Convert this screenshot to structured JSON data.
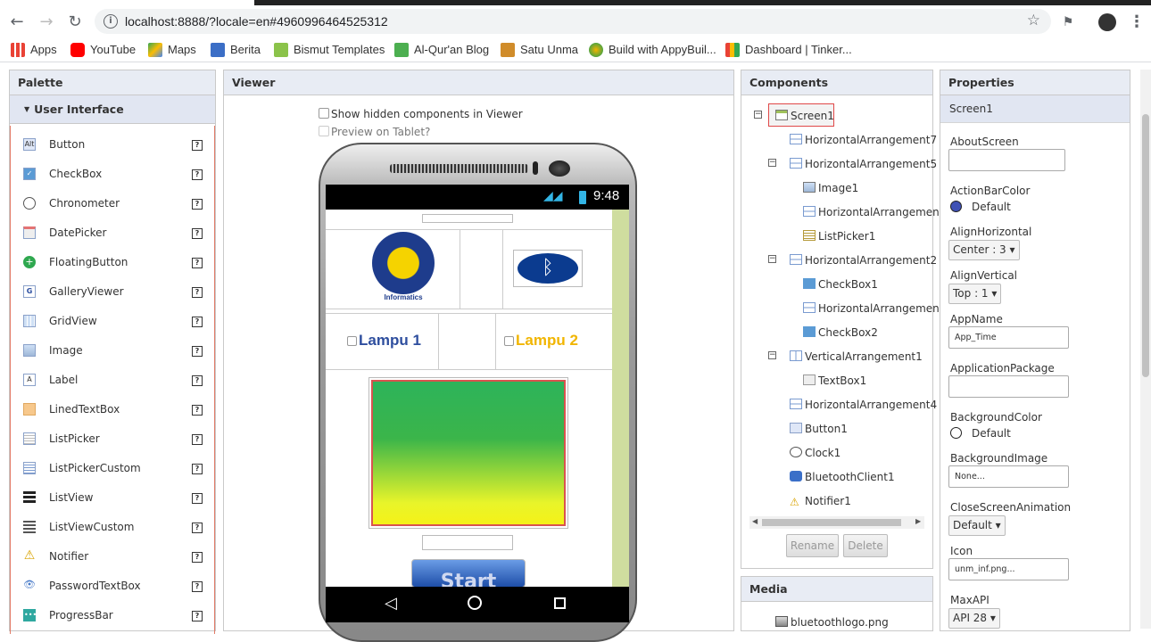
{
  "browser": {
    "url": "localhost:8888/?locale=en#4960996464525312",
    "bookmarks": [
      "Apps",
      "YouTube",
      "Maps",
      "Berita",
      "Bismut Templates",
      "Al-Qur'an Blog",
      "Satu Unma",
      "Build with AppyBuil...",
      "Dashboard | Tinker..."
    ]
  },
  "palette": {
    "title": "Palette",
    "section": "User Interface",
    "items": [
      "Button",
      "CheckBox",
      "Chronometer",
      "DatePicker",
      "FloatingButton",
      "GalleryViewer",
      "GridView",
      "Image",
      "Label",
      "LinedTextBox",
      "ListPicker",
      "ListPickerCustom",
      "ListView",
      "ListViewCustom",
      "Notifier",
      "PasswordTextBox",
      "ProgressBar"
    ],
    "help_glyph": "?"
  },
  "viewer": {
    "title": "Viewer",
    "show_hidden": "Show hidden components in Viewer",
    "preview_tablet": "Preview on Tablet?",
    "time": "9:48",
    "logo_text": "Informatics",
    "check1": "Lampu 1",
    "check2": "Lampu 2",
    "start": "Start"
  },
  "components": {
    "title": "Components",
    "tree": [
      "Screen1",
      "HorizontalArrangement7",
      "HorizontalArrangement5",
      "Image1",
      "HorizontalArrangemen",
      "ListPicker1",
      "HorizontalArrangement2",
      "CheckBox1",
      "HorizontalArrangemen",
      "CheckBox2",
      "VerticalArrangement1",
      "TextBox1",
      "HorizontalArrangement4",
      "Button1",
      "Clock1",
      "BluetoothClient1",
      "Notifier1"
    ],
    "rename": "Rename",
    "delete": "Delete",
    "collapse_glyph": "−"
  },
  "media": {
    "title": "Media",
    "items": [
      "bluetoothlogo.png"
    ]
  },
  "properties": {
    "title": "Properties",
    "screen": "Screen1",
    "about_screen": "AboutScreen",
    "action_bar_color": "ActionBarColor",
    "action_bar_color_value": "Default",
    "align_horizontal": "AlignHorizontal",
    "align_horizontal_value": "Center : 3 ▾",
    "align_vertical": "AlignVertical",
    "align_vertical_value": "Top : 1 ▾",
    "app_name": "AppName",
    "app_name_value": "App_Time",
    "application_package": "ApplicationPackage",
    "background_color": "BackgroundColor",
    "background_color_value": "Default",
    "background_image": "BackgroundImage",
    "background_image_value": "None...",
    "close_screen_animation": "CloseScreenAnimation",
    "close_screen_animation_value": "Default ▾",
    "icon": "Icon",
    "icon_value": "unm_inf.png...",
    "max_api": "MaxAPI",
    "max_api_value": "API 28 ▾"
  }
}
